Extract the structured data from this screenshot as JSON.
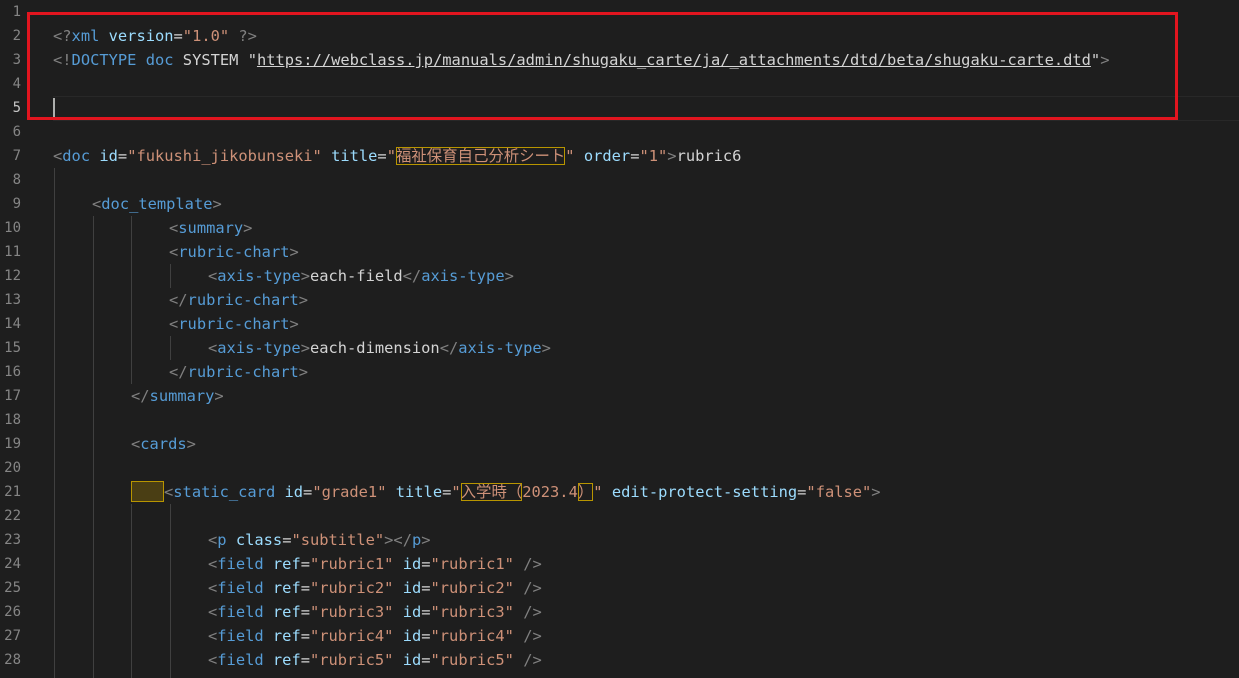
{
  "editor": {
    "line_numbers": [
      "1",
      "2",
      "3",
      "4",
      "5",
      "6",
      "7",
      "8",
      "9",
      "10",
      "11",
      "12",
      "13",
      "14",
      "15",
      "16",
      "17",
      "18",
      "19",
      "20",
      "21",
      "22",
      "23",
      "24",
      "25",
      "26",
      "27",
      "28"
    ],
    "active_line": 5,
    "lines": {
      "l2": {
        "open": "<?",
        "name": "xml",
        "attr": "version",
        "eq": "=",
        "val": "\"1.0\"",
        "close": " ?>"
      },
      "l3": {
        "open": "<!",
        "name": "DOCTYPE",
        "word1": "doc",
        "word2": "SYSTEM",
        "q1": "\"",
        "url": "https://webclass.jp/manuals/admin/shugaku_carte/ja/_attachments/dtd/beta/shugaku-carte.dtd",
        "q2": "\"",
        "close": ">"
      },
      "l7": {
        "lt": "<",
        "tag": "doc",
        "a1": "id",
        "eq1": "=",
        "v1": "\"fukushi_jikobunseki\"",
        "a2": "title",
        "eq2": "=",
        "q_open": "\"",
        "title_jp": "福祉保育自己分析シート",
        "q_close": "\"",
        "a3": "order",
        "eq3": "=",
        "v3": "\"1\"",
        "gt": ">",
        "text": "rubric6"
      },
      "l9": {
        "lt": "<",
        "tag": "doc_template",
        "gt": ">"
      },
      "l10": {
        "lt": "<",
        "tag": "summary",
        "gt": ">"
      },
      "l11": {
        "lt": "<",
        "tag": "rubric-chart",
        "gt": ">"
      },
      "l12": {
        "lt": "<",
        "tag": "axis-type",
        "gt": ">",
        "text": "each-field",
        "lt2": "</",
        "tag2": "axis-type",
        "gt2": ">"
      },
      "l13": {
        "lt": "</",
        "tag": "rubric-chart",
        "gt": ">"
      },
      "l14": {
        "lt": "<",
        "tag": "rubric-chart",
        "gt": ">"
      },
      "l15": {
        "lt": "<",
        "tag": "axis-type",
        "gt": ">",
        "text": "each-dimension",
        "lt2": "</",
        "tag2": "axis-type",
        "gt2": ">"
      },
      "l16": {
        "lt": "</",
        "tag": "rubric-chart",
        "gt": ">"
      },
      "l17": {
        "lt": "</",
        "tag": "summary",
        "gt": ">"
      },
      "l19": {
        "lt": "<",
        "tag": "cards",
        "gt": ">"
      },
      "l21": {
        "lt": "<",
        "tag": "static_card",
        "a1": "id",
        "eq1": "=",
        "v1": "\"grade1\"",
        "a2": "title",
        "eq2": "=",
        "q_open": "\"",
        "title_jp": "入学時（",
        "title_num": "2023.4",
        "title_paren": "）",
        "q_close": "\"",
        "a3": "edit-protect-setting",
        "eq3": "=",
        "v3": "\"false\"",
        "gt": ">"
      },
      "l23": {
        "lt": "<",
        "tag": "p",
        "a1": "class",
        "eq1": "=",
        "v1": "\"subtitle\"",
        "gt": ">",
        "lt2": "</",
        "tag2": "p",
        "gt2": ">"
      },
      "fields": [
        {
          "lt": "<",
          "tag": "field",
          "a1": "ref",
          "eq1": "=",
          "v1": "\"rubric1\"",
          "a2": "id",
          "eq2": "=",
          "v2": "\"rubric1\"",
          "end": " />"
        },
        {
          "lt": "<",
          "tag": "field",
          "a1": "ref",
          "eq1": "=",
          "v1": "\"rubric2\"",
          "a2": "id",
          "eq2": "=",
          "v2": "\"rubric2\"",
          "end": " />"
        },
        {
          "lt": "<",
          "tag": "field",
          "a1": "ref",
          "eq1": "=",
          "v1": "\"rubric3\"",
          "a2": "id",
          "eq2": "=",
          "v2": "\"rubric3\"",
          "end": " />"
        },
        {
          "lt": "<",
          "tag": "field",
          "a1": "ref",
          "eq1": "=",
          "v1": "\"rubric4\"",
          "a2": "id",
          "eq2": "=",
          "v2": "\"rubric4\"",
          "end": " />"
        },
        {
          "lt": "<",
          "tag": "field",
          "a1": "ref",
          "eq1": "=",
          "v1": "\"rubric5\"",
          "a2": "id",
          "eq2": "=",
          "v2": "\"rubric5\"",
          "end": " />"
        }
      ]
    },
    "colors": {
      "background": "#1e1e1e",
      "tag": "#569cd6",
      "attribute": "#9cdcfe",
      "string": "#ce9178",
      "text": "#d4d4d4",
      "line_number": "#858585",
      "highlight_box": "#e2151f",
      "warning_outline": "#b89500"
    }
  }
}
